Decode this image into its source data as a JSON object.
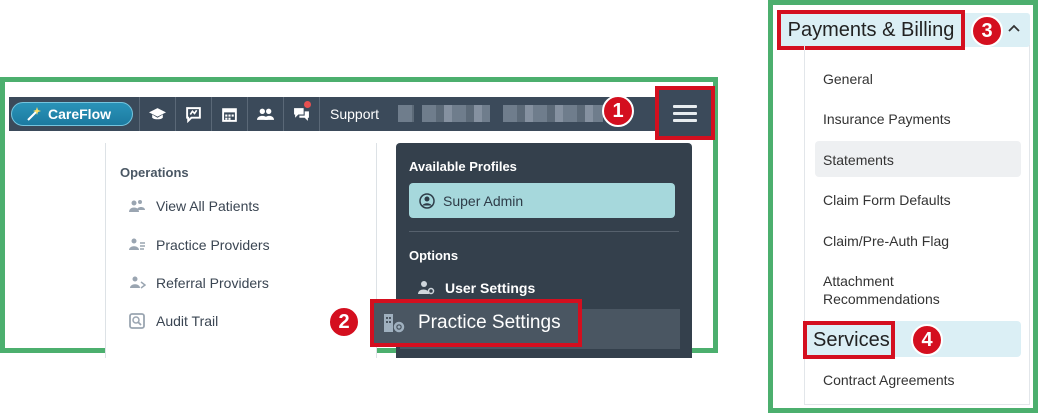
{
  "colors": {
    "frame_green": "#4caf6e",
    "highlight_red": "#d40f1f",
    "topbar": "#3b4a5a",
    "profile_panel": "#34404c",
    "active_profile": "#a6d8dc",
    "selected_menu": "#dbeff5"
  },
  "topbar": {
    "brand_label": "CareFlow",
    "icons": [
      "graduation-cap-icon",
      "chat-bubble-icon",
      "calendar-icon",
      "users-icon",
      "messages-icon"
    ],
    "support_label": "Support"
  },
  "operations": {
    "title": "Operations",
    "items": [
      {
        "label": "View All Patients",
        "icon": "patients-icon"
      },
      {
        "label": "Practice Providers",
        "icon": "providers-icon"
      },
      {
        "label": "Referral Providers",
        "icon": "referral-icon"
      },
      {
        "label": "Audit Trail",
        "icon": "audit-icon"
      }
    ]
  },
  "profiles": {
    "title": "Available Profiles",
    "active_profile": "Super Admin",
    "options_title": "Options",
    "user_settings": "User Settings",
    "practice_settings": "Practice Settings"
  },
  "billing_menu": {
    "header": "Payments & Billing",
    "items": [
      "General",
      "Insurance Payments",
      "Statements",
      "Claim Form Defaults",
      "Claim/Pre-Auth Flag",
      "Attachment Recommendations",
      "Services",
      "Contract Agreements"
    ]
  },
  "step_badges": [
    "1",
    "2",
    "3",
    "4"
  ]
}
